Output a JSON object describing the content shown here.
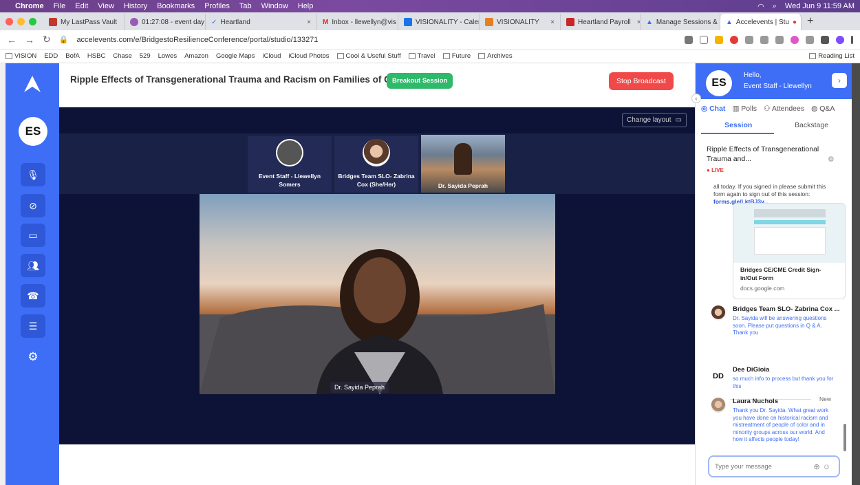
{
  "menubar": {
    "app": "Chrome",
    "items": [
      "File",
      "Edit",
      "View",
      "History",
      "Bookmarks",
      "Profiles",
      "Tab",
      "Window",
      "Help"
    ],
    "clock": "Wed Jun 9  11:59 AM"
  },
  "tabs": [
    {
      "label": "My LastPass Vault",
      "color": "#c0392b"
    },
    {
      "label": "01:27:08 - event day",
      "color": "#9b59b6"
    },
    {
      "label": "Heartland",
      "color": "#3d6ef5"
    },
    {
      "label": "Inbox - llewellyn@vis",
      "color": "#d93025"
    },
    {
      "label": "VISIONALITY - Calen",
      "color": "#1a73e8"
    },
    {
      "label": "VISIONALITY",
      "color": "#e67e22"
    },
    {
      "label": "Heartland Payroll",
      "color": "#c62828"
    },
    {
      "label": "Manage Sessions & S",
      "color": "#3d6ef5"
    },
    {
      "label": "Accelevents | Stu",
      "color": "#3d6ef5"
    }
  ],
  "url": "accelevents.com/e/BridgestoResilienceConference/portal/studio/133271",
  "bookmarks": [
    "VISION",
    "EDD",
    "BofA",
    "HSBC",
    "Chase",
    "529",
    "Lowes",
    "Amazon",
    "Google Maps",
    "iCloud",
    "iCloud Photos",
    "Cool & Useful Stuff",
    "Travel",
    "Future",
    "Archives"
  ],
  "reading_list": "Reading List",
  "leftnav": {
    "avatar": "ES"
  },
  "header": {
    "title": "Ripple Effects of Transgenerational Trauma and Racism on Families of Color",
    "badge": "Breakout Session",
    "stop": "Stop Broadcast"
  },
  "stage": {
    "change_layout": "Change layout",
    "thumbs": [
      {
        "name": "Event Staff - Llewellyn Somers"
      },
      {
        "name": "Bridges Team SLO- Zabrina Cox (She/Her)"
      },
      {
        "name": "Dr. Sayida Peprah"
      }
    ],
    "main_name": "Dr. Sayida Peprah"
  },
  "sidebar": {
    "avatar": "ES",
    "hello": "Hello,",
    "user": "Event Staff - Llewellyn",
    "tabs": [
      "Chat",
      "Polls",
      "Attendees",
      "Q&A"
    ],
    "subtabs": [
      "Session",
      "Backstage"
    ],
    "session_title": "Ripple Effects of Transgenerational Trauma and...",
    "live": "LIVE",
    "partial_msg": "all today. If you signed in please submit this form again to sign out of this session:",
    "partial_link": "forms.gle/LktBJ3v...",
    "preview_title": "Bridges CE/CME Credit Sign-in/Out Form",
    "preview_domain": "docs.google.com",
    "messages": [
      {
        "author": "Bridges Team SLO- Zabrina Cox ...",
        "body": "Dr. Sayida will be answering questions soon. Please put questions in Q & A. Thank you"
      },
      {
        "author": "Dee DiGioia",
        "initials": "DD",
        "body": "so much info to process but thank you for this"
      },
      {
        "author": "Laura Nuchols",
        "body": "Thank you Dr. Sayida. What great work you have done on historical racism and mistreatment of people of color and in minority groups across our world. And how it affects people today!"
      }
    ],
    "new_label": "New",
    "composer_placeholder": "Type your message"
  }
}
